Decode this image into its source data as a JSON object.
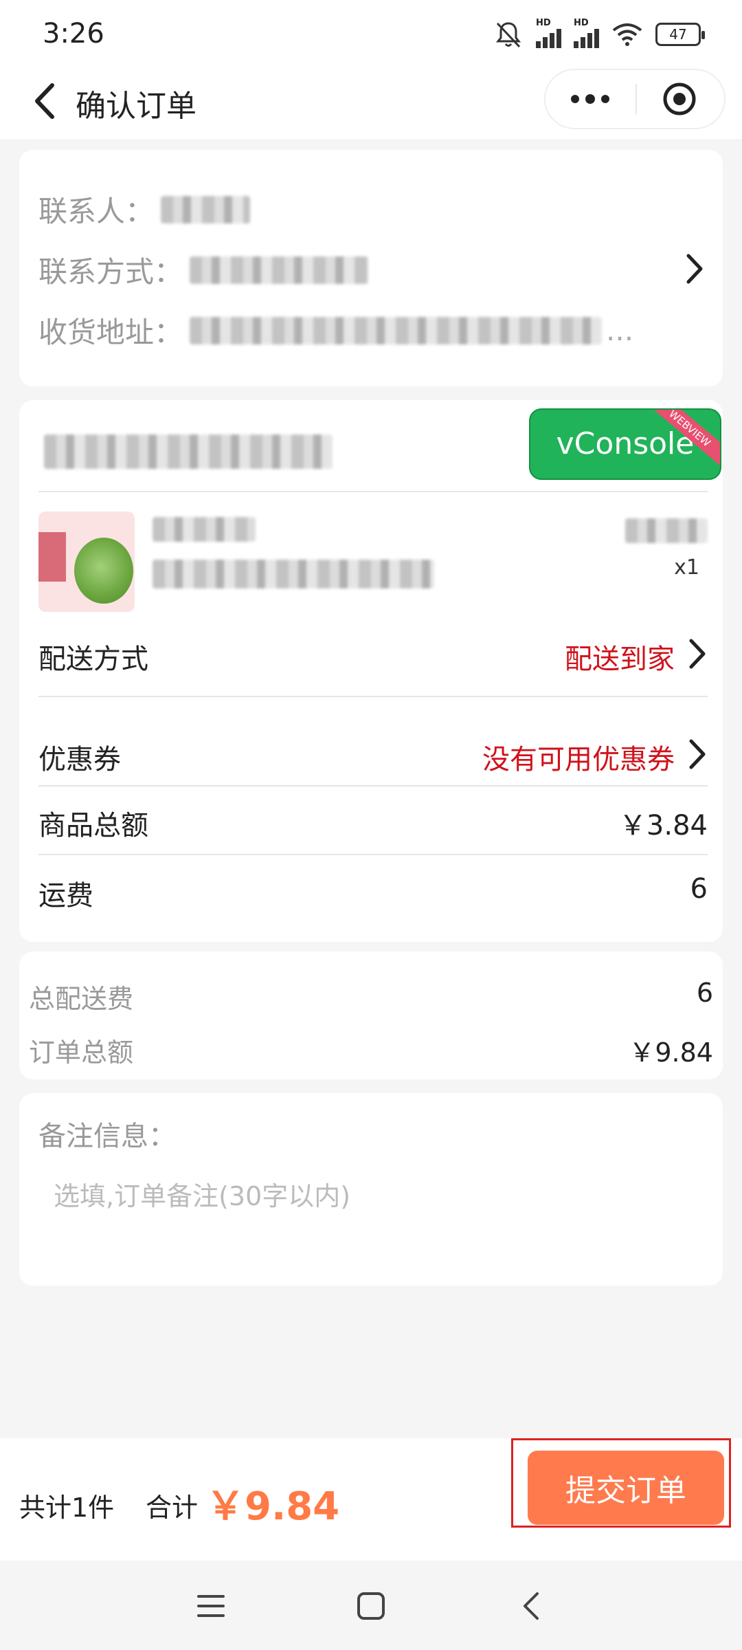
{
  "status_bar": {
    "time": "3:26",
    "hd1": "HD",
    "hd2": "HD",
    "battery": "47"
  },
  "nav": {
    "title": "确认订单"
  },
  "address": {
    "contact_label": "联系人：",
    "phone_label": "联系方式：",
    "address_label": "收货地址：",
    "address_ellipsis": "..."
  },
  "debug": {
    "vconsole_label": "vConsole",
    "vconsole_badge": "WEBVIEW"
  },
  "goods": {
    "qty": "x1"
  },
  "order": {
    "delivery_label": "配送方式",
    "delivery_value": "配送到家",
    "coupon_label": "优惠券",
    "coupon_value": "没有可用优惠券",
    "goods_total_label": "商品总额",
    "goods_total_value": "￥3.84",
    "shipping_label": "运费",
    "shipping_value": "6"
  },
  "summary": {
    "total_delivery_label": "总配送费",
    "total_delivery_value": "6",
    "order_total_label": "订单总额",
    "order_total_value": "￥9.84"
  },
  "remark": {
    "label": "备注信息：",
    "placeholder": "选填,订单备注(30字以内)"
  },
  "footer": {
    "count": "共计1件",
    "total_label": "合计",
    "total_value": "￥9.84",
    "submit_label": "提交订单"
  },
  "colors": {
    "accent": "#ff7a45",
    "red": "#d0121b",
    "vconsole": "#21b35a"
  },
  "icons": [
    "back-icon",
    "more-icon",
    "target-icon",
    "chevron-right-icon",
    "menu-icon",
    "home-icon",
    "back-nav-icon",
    "mute-icon",
    "wifi-icon"
  ]
}
